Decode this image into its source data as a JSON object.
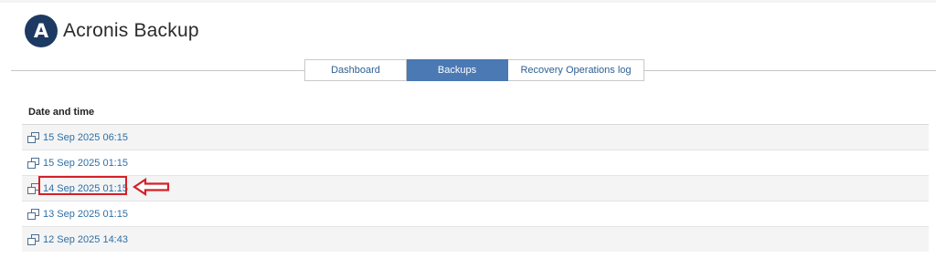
{
  "app": {
    "logo_letter": "A",
    "title": "Acronis Backup"
  },
  "tabs": [
    {
      "label": "Dashboard",
      "active": false
    },
    {
      "label": "Backups",
      "active": true
    },
    {
      "label": "Recovery Operations log",
      "active": false
    }
  ],
  "table": {
    "header": "Date and time",
    "rows": [
      {
        "label": "15 Sep 2025 06:15"
      },
      {
        "label": "15 Sep 2025 01:15"
      },
      {
        "label": "14 Sep 2025 01:15",
        "highlighted": true
      },
      {
        "label": "13 Sep 2025 01:15"
      },
      {
        "label": "12 Sep 2025 14:43"
      }
    ]
  },
  "colors": {
    "logo_bg": "#1d3a62",
    "tab_active_bg": "#4a79b3",
    "link": "#2d6fa6",
    "annotation": "#d42027"
  },
  "icons": {
    "row_icon": "restore-copy-icon"
  }
}
